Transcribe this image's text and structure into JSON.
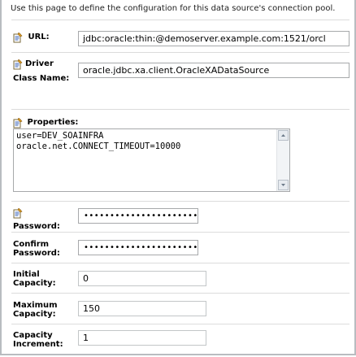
{
  "intro": "Use this page to define the configuration for this data source's connection pool.",
  "fields": {
    "url": {
      "label": "URL:",
      "value": "jdbc:oracle:thin:@demoserver.example.com:1521/orcl"
    },
    "driver": {
      "label_line1": "Driver",
      "label_line2": "Class Name:",
      "value": "oracle.jdbc.xa.client.OracleXADataSource"
    },
    "properties": {
      "label": "Properties:",
      "lines": [
        "user=DEV_SOAINFRA",
        "oracle.net.CONNECT_TIMEOUT=10000"
      ]
    },
    "password": {
      "label": "Password:",
      "value": "•••••••••••••••••••••••"
    },
    "confirm_password": {
      "label_line1": "Confirm",
      "label_line2": "Password:",
      "value": "••••••••••••••••••••••••"
    },
    "initial_capacity": {
      "label_line1": "Initial",
      "label_line2": "Capacity:",
      "value": "0"
    },
    "maximum_capacity": {
      "label_line1": "Maximum",
      "label_line2": "Capacity:",
      "value": "150"
    },
    "capacity_increment": {
      "label_line1": "Capacity",
      "label_line2": "Increment:",
      "value": "1"
    }
  },
  "icons": {
    "field_help": "help-note-icon",
    "scroll_up": "scroll-up-arrow-icon",
    "scroll_down": "scroll-down-arrow-icon"
  }
}
